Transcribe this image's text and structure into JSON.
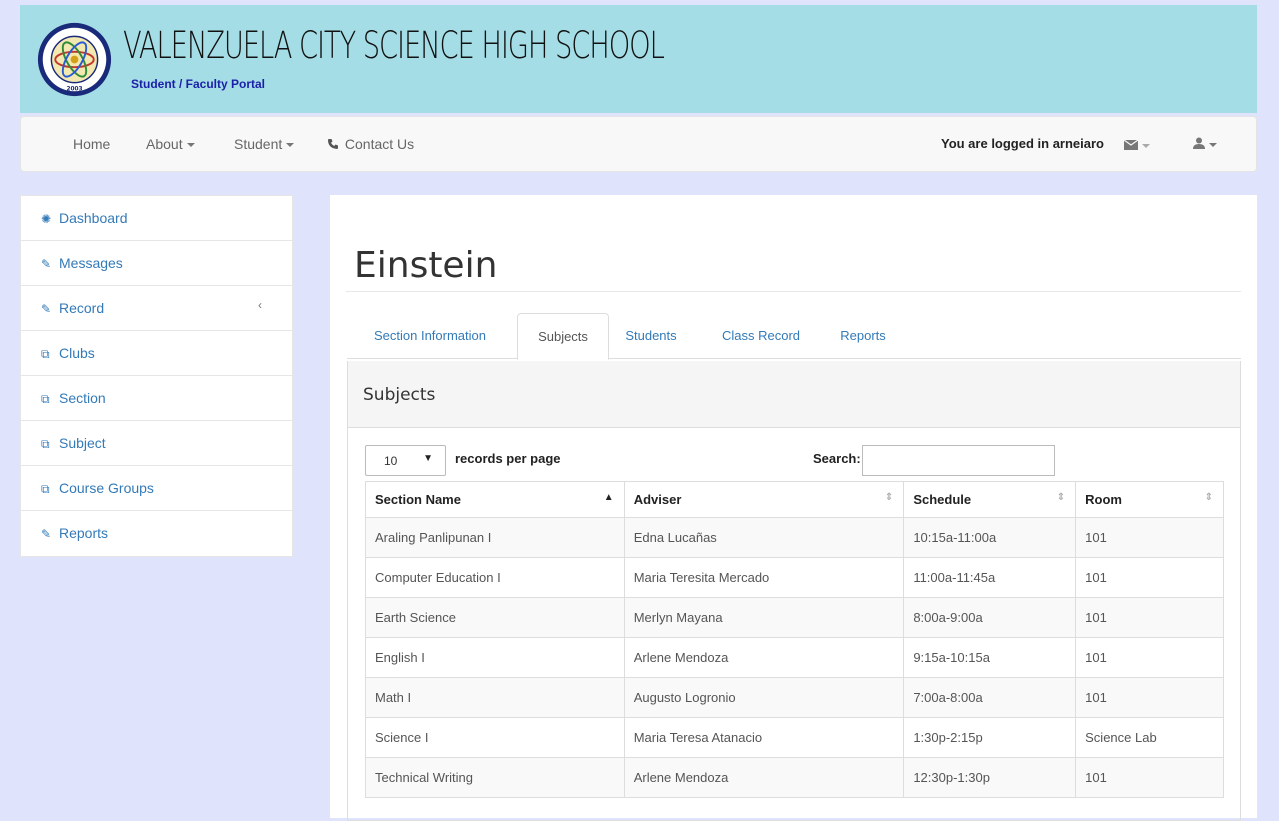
{
  "header": {
    "school_name": "VALENZUELA CITY SCIENCE HIGH SCHOOL",
    "portal_label": "Student / Faculty Portal",
    "logo_year": "2003"
  },
  "nav": {
    "home": "Home",
    "about": "About",
    "student": "Student",
    "contact": "Contact Us",
    "logged_in_text": "You are logged in arneiaro"
  },
  "sidebar": {
    "items": [
      {
        "label": "Dashboard",
        "icon": "dashboard-icon"
      },
      {
        "label": "Messages",
        "icon": "edit-icon"
      },
      {
        "label": "Record",
        "icon": "edit-icon"
      },
      {
        "label": "Clubs",
        "icon": "copy-icon"
      },
      {
        "label": "Section",
        "icon": "copy-icon"
      },
      {
        "label": "Subject",
        "icon": "copy-icon"
      },
      {
        "label": "Course Groups",
        "icon": "copy-icon"
      },
      {
        "label": "Reports",
        "icon": "edit-icon"
      }
    ]
  },
  "main": {
    "title": "Einstein",
    "tabs": [
      {
        "label": "Section Information"
      },
      {
        "label": "Subjects"
      },
      {
        "label": "Students"
      },
      {
        "label": "Class Record"
      },
      {
        "label": "Reports"
      }
    ],
    "active_tab": "Subjects",
    "panel_title": "Subjects",
    "page_length": "10",
    "records_label": "records per page",
    "search_label": "Search:",
    "search_value": "",
    "columns": [
      "Section Name",
      "Adviser",
      "Schedule",
      "Room"
    ],
    "rows": [
      [
        "Araling Panlipunan I",
        "Edna Lucañas",
        "10:15a-11:00a",
        "101"
      ],
      [
        "Computer Education I",
        "Maria Teresita Mercado",
        "11:00a-11:45a",
        "101"
      ],
      [
        "Earth Science",
        "Merlyn Mayana",
        "8:00a-9:00a",
        "101"
      ],
      [
        "English I",
        "Arlene Mendoza",
        "9:15a-10:15a",
        "101"
      ],
      [
        "Math I",
        "Augusto Logronio",
        "7:00a-8:00a",
        "101"
      ],
      [
        "Science I",
        "Maria Teresa Atanacio",
        "1:30p-2:15p",
        "Science Lab"
      ],
      [
        "Technical Writing",
        "Arlene Mendoza",
        "12:30p-1:30p",
        "101"
      ]
    ]
  }
}
